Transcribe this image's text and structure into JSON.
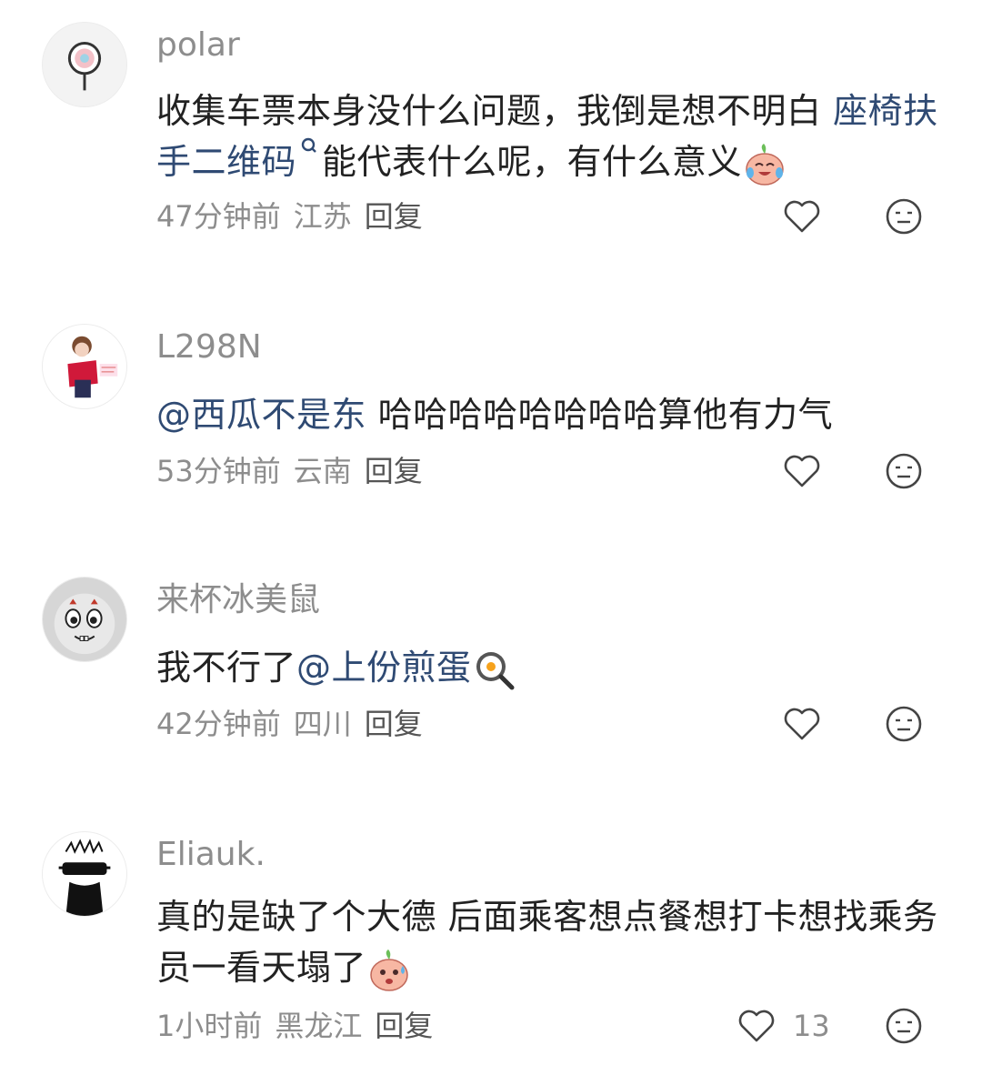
{
  "comments": [
    {
      "username": "polar",
      "text_a": "收集车票本身没什么问题，我倒是想不明白 ",
      "link": "座椅扶手二维码",
      "text_b": "能代表什么呢，有什么意义",
      "time": "47分钟前",
      "location": "江苏",
      "reply": "回复",
      "likes": ""
    },
    {
      "username": "L298N",
      "mention": "@西瓜不是东",
      "text_a": " 哈哈哈哈哈哈哈哈算他有力气",
      "time": "53分钟前",
      "location": "云南",
      "reply": "回复",
      "likes": ""
    },
    {
      "username": "来杯冰美鼠",
      "text_a": "我不行了",
      "mention": "@上份煎蛋",
      "time": "42分钟前",
      "location": "四川",
      "reply": "回复",
      "likes": ""
    },
    {
      "username": "Eliauk.",
      "text_a": "真的是缺了个大德 后面乘客想点餐想打卡想找乘务员一看天塌了",
      "time": "1小时前",
      "location": "黑龙江",
      "reply": "回复",
      "likes": "13"
    }
  ],
  "icons": {
    "like": "heart-outline-icon",
    "dislike": "neutral-face-icon",
    "link_search": "search-icon",
    "emoji_cry_laugh": "crying-laughing-peach-emoji",
    "emoji_egg": "fried-egg-pan-emoji",
    "emoji_sweat": "sweat-peach-emoji"
  },
  "colors": {
    "link": "#2f4a73",
    "text": "#222222",
    "meta": "#8d8d8d"
  }
}
